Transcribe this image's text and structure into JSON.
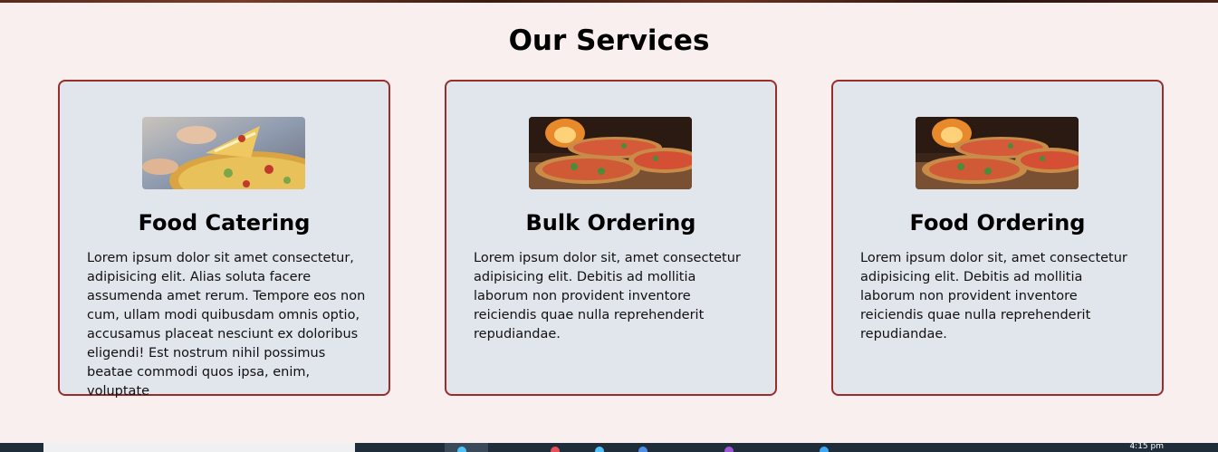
{
  "section": {
    "title": "Our Services"
  },
  "cards": [
    {
      "title": "Food Catering",
      "image": "pizza-slice-photo",
      "text": "Lorem ipsum dolor sit amet consectetur, adipisicing elit. Alias soluta facere assumenda amet rerum. Tempore eos non cum, ullam modi quibusdam omnis optio, accusamus placeat nesciunt ex doloribus eligendi! Est nostrum nihil possimus beatae commodi quos ipsa, enim, voluptate"
    },
    {
      "title": "Bulk Ordering",
      "image": "pizzas-oven-photo",
      "text": "Lorem ipsum dolor sit, amet consectetur adipisicing elit. Debitis ad mollitia laborum non provident inventore reiciendis quae nulla reprehenderit repudiandae."
    },
    {
      "title": "Food Ordering",
      "image": "pizzas-oven-photo",
      "text": "Lorem ipsum dolor sit, amet consectetur adipisicing elit. Debitis ad mollitia laborum non provident inventore reiciendis quae nulla reprehenderit repudiandae."
    }
  ],
  "colors": {
    "background": "#f9efef",
    "card_background": "#e1e5ec",
    "card_border": "#9b2c2c",
    "taskbar": "#1f2d3a"
  },
  "taskbar": {
    "clock": "4:15 pm"
  }
}
